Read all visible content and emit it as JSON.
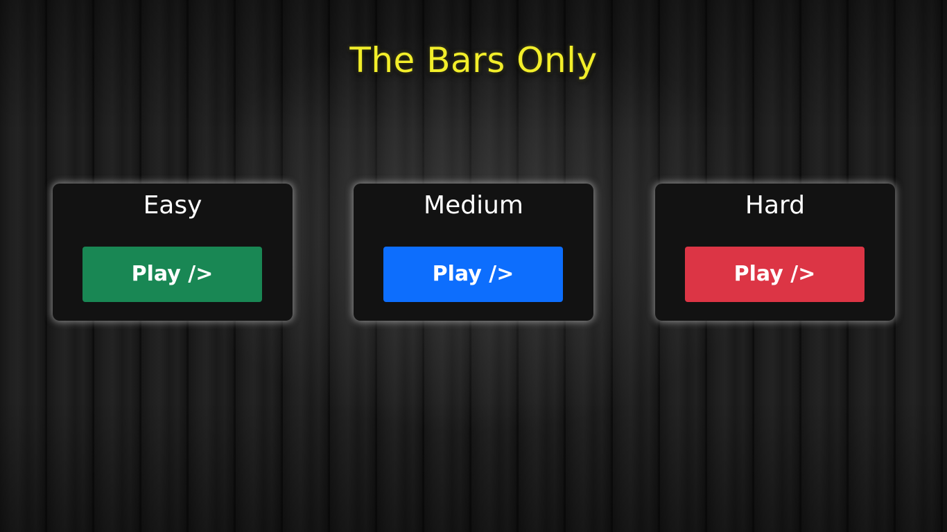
{
  "title": "The Bars Only",
  "levels": [
    {
      "label": "Easy",
      "button": "Play />",
      "color": "#198754"
    },
    {
      "label": "Medium",
      "button": "Play />",
      "color": "#0d6efd"
    },
    {
      "label": "Hard",
      "button": "Play />",
      "color": "#dc3545"
    }
  ],
  "title_color": "#f2ee2a"
}
